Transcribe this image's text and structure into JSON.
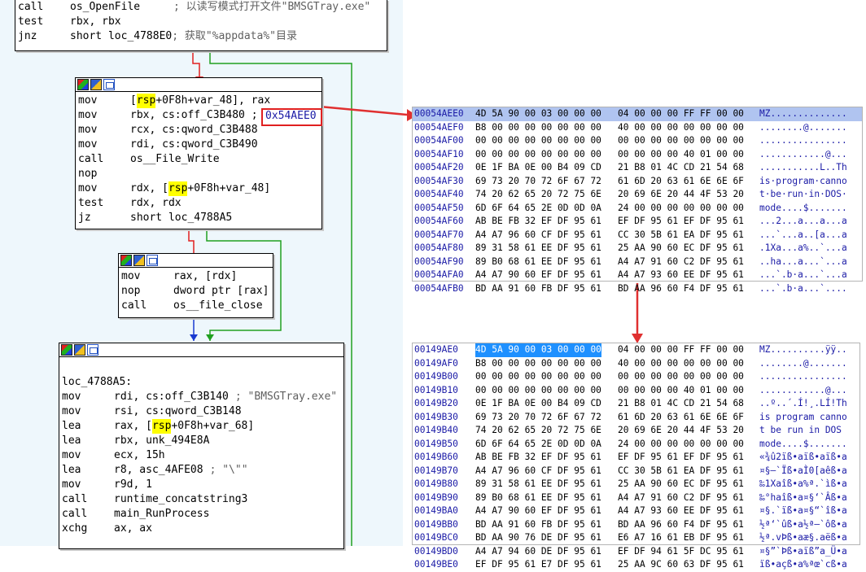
{
  "top_block": [
    {
      "m": "call",
      "o": "os_OpenFile",
      "c": "; 以读写模式打开文件\"BMSGTray.exe\""
    },
    {
      "m": "test",
      "o": "rbx, rbx",
      "c": ""
    },
    {
      "m": "jnz",
      "o": "short loc_4788E0",
      "c": "; 获取\"%appdata%\"目录"
    }
  ],
  "block2": [
    {
      "m": "mov",
      "pre": "[",
      "hl": "rsp",
      "post": "+0F8h+var_48], rax"
    },
    {
      "m": "mov",
      "pre": "rbx, cs:off_C3B480 ;",
      "hl": "",
      "post": ""
    },
    {
      "m": "mov",
      "pre": "rcx, cs:qword_C3B488",
      "hl": "",
      "post": ""
    },
    {
      "m": "mov",
      "pre": "rdi, cs:qword_C3B490",
      "hl": "",
      "post": ""
    },
    {
      "m": "call",
      "pre": "os__File_Write",
      "hl": "",
      "post": ""
    },
    {
      "m": "nop",
      "pre": "",
      "hl": "",
      "post": ""
    },
    {
      "m": "mov",
      "pre": "rdx, [",
      "hl": "rsp",
      "post": "+0F8h+var_48]"
    },
    {
      "m": "test",
      "pre": "rdx, rdx",
      "hl": "",
      "post": ""
    },
    {
      "m": "jz",
      "pre": "short loc_4788A5",
      "hl": "",
      "post": ""
    }
  ],
  "block2_annot": "0x54AEE0",
  "block3": [
    {
      "m": "mov",
      "o": "rax, [rdx]"
    },
    {
      "m": "nop",
      "o": "dword ptr [rax]"
    },
    {
      "m": "call",
      "o": "os__file_close"
    }
  ],
  "block4_label": "loc_4788A5:",
  "block4": [
    {
      "m": "mov",
      "pre": "rdi, cs:off_C3B140",
      "hl": "",
      "post": "",
      "c": "; \"BMSGTray.exe\""
    },
    {
      "m": "mov",
      "pre": "rsi, cs:qword_C3B148",
      "hl": "",
      "post": "",
      "c": ""
    },
    {
      "m": "lea",
      "pre": "rax, [",
      "hl": "rsp",
      "post": "+0F8h+var_68]",
      "c": ""
    },
    {
      "m": "lea",
      "pre": "rbx, unk_494E8A",
      "hl": "",
      "post": "",
      "c": ""
    },
    {
      "m": "mov",
      "pre": "ecx, 15h",
      "hl": "",
      "post": "",
      "c": ""
    },
    {
      "m": "lea",
      "pre": "r8, asc_4AFE08",
      "hl": "",
      "post": "",
      "c": "; \"\\\"\""
    },
    {
      "m": "mov",
      "pre": "r9d, 1",
      "hl": "",
      "post": "",
      "c": ""
    },
    {
      "m": "call",
      "pre": "runtime_concatstring3",
      "hl": "",
      "post": "",
      "c": ""
    },
    {
      "m": "call",
      "pre": "main_RunProcess",
      "hl": "",
      "post": "",
      "c": ""
    },
    {
      "m": "xchg",
      "pre": "ax, ax",
      "hl": "",
      "post": "",
      "c": ""
    }
  ],
  "hex1": [
    {
      "a": "00054AEE0",
      "b": "4D 5A 90 00 03 00 00 00",
      "c": "04 00 00 00 FF FF 00 00",
      "t": "MZ.............."
    },
    {
      "a": "00054AEF0",
      "b": "B8 00 00 00 00 00 00 00",
      "c": "40 00 00 00 00 00 00 00",
      "t": "........@......."
    },
    {
      "a": "00054AF00",
      "b": "00 00 00 00 00 00 00 00",
      "c": "00 00 00 00 00 00 00 00",
      "t": "................"
    },
    {
      "a": "00054AF10",
      "b": "00 00 00 00 00 00 00 00",
      "c": "00 00 00 00 40 01 00 00",
      "t": "............@..."
    },
    {
      "a": "00054AF20",
      "b": "0E 1F BA 0E 00 B4 09 CD",
      "c": "21 B8 01 4C CD 21 54 68",
      "t": "...........L..Th"
    },
    {
      "a": "00054AF30",
      "b": "69 73 20 70 72 6F 67 72",
      "c": "61 6D 20 63 61 6E 6E 6F",
      "t": "is·program·canno"
    },
    {
      "a": "00054AF40",
      "b": "74 20 62 65 20 72 75 6E",
      "c": "20 69 6E 20 44 4F 53 20",
      "t": "t·be·run·in·DOS·"
    },
    {
      "a": "00054AF50",
      "b": "6D 6F 64 65 2E 0D 0D 0A",
      "c": "24 00 00 00 00 00 00 00",
      "t": "mode....$......."
    },
    {
      "a": "00054AF60",
      "b": "AB BE FB 32 EF DF 95 61",
      "c": "EF DF 95 61 EF DF 95 61",
      "t": "...2...a...a...a"
    },
    {
      "a": "00054AF70",
      "b": "A4 A7 96 60 CF DF 95 61",
      "c": "CC 30 5B 61 EA DF 95 61",
      "t": "...`...a..[a...a"
    },
    {
      "a": "00054AF80",
      "b": "89 31 58 61 EE DF 95 61",
      "c": "25 AA 90 60 EC DF 95 61",
      "t": ".1Xa...a%..`...a"
    },
    {
      "a": "00054AF90",
      "b": "89 B0 68 61 EE DF 95 61",
      "c": "A4 A7 91 60 C2 DF 95 61",
      "t": "..ha...a...`...a"
    },
    {
      "a": "00054AFA0",
      "b": "A4 A7 90 60 EF DF 95 61",
      "c": "A4 A7 93 60 EE DF 95 61",
      "t": "...`.b·a...`...a"
    },
    {
      "a": "00054AFB0",
      "b": "BD AA 91 60 FB DF 95 61",
      "c": "BD AA 96 60 F4 DF 95 61",
      "t": "...`.b·a...`...."
    }
  ],
  "hex2": [
    {
      "a": "00149AE0",
      "b": "4D 5A 90 00 03 00 00 00",
      "c": "04 00 00 00 FF FF 00 00",
      "t": "MZ..........ÿÿ.."
    },
    {
      "a": "00149AF0",
      "b": "B8 00 00 00 00 00 00 00",
      "c": "40 00 00 00 00 00 00 00",
      "t": "........@......."
    },
    {
      "a": "00149B00",
      "b": "00 00 00 00 00 00 00 00",
      "c": "00 00 00 00 00 00 00 00",
      "t": "................"
    },
    {
      "a": "00149B10",
      "b": "00 00 00 00 00 00 00 00",
      "c": "00 00 00 00 40 01 00 00",
      "t": "............@..."
    },
    {
      "a": "00149B20",
      "b": "0E 1F BA 0E 00 B4 09 CD",
      "c": "21 B8 01 4C CD 21 54 68",
      "t": "..º..´.Í!¸.LÍ!Th"
    },
    {
      "a": "00149B30",
      "b": "69 73 20 70 72 6F 67 72",
      "c": "61 6D 20 63 61 6E 6E 6F",
      "t": "is program canno"
    },
    {
      "a": "00149B40",
      "b": "74 20 62 65 20 72 75 6E",
      "c": "20 69 6E 20 44 4F 53 20",
      "t": "t be run in DOS "
    },
    {
      "a": "00149B50",
      "b": "6D 6F 64 65 2E 0D 0D 0A",
      "c": "24 00 00 00 00 00 00 00",
      "t": "mode....$......."
    },
    {
      "a": "00149B60",
      "b": "AB BE FB 32 EF DF 95 61",
      "c": "EF DF 95 61 EF DF 95 61",
      "t": "«¾û2ïß•aïß•aïß•a"
    },
    {
      "a": "00149B70",
      "b": "A4 A7 96 60 CF DF 95 61",
      "c": "CC 30 5B 61 EA DF 95 61",
      "t": "¤§–`Ïß•aÌ0[aêß•a"
    },
    {
      "a": "00149B80",
      "b": "89 31 58 61 EE DF 95 61",
      "c": "25 AA 90 60 EC DF 95 61",
      "t": "‰1Xaîß•a%ª.`ìß•a"
    },
    {
      "a": "00149B90",
      "b": "89 B0 68 61 EE DF 95 61",
      "c": "A4 A7 91 60 C2 DF 95 61",
      "t": "‰°haîß•a¤§‘`Âß•a"
    },
    {
      "a": "00149BA0",
      "b": "A4 A7 90 60 EF DF 95 61",
      "c": "A4 A7 93 60 EE DF 95 61",
      "t": "¤§.`ïß•a¤§“`îß•a"
    },
    {
      "a": "00149BB0",
      "b": "BD AA 91 60 FB DF 95 61",
      "c": "BD AA 96 60 F4 DF 95 61",
      "t": "½ª‘`ûß•a½ª–`ôß•a"
    },
    {
      "a": "00149BC0",
      "b": "BD AA 90 76 DE DF 95 61",
      "c": "E6 A7 16 61 EB DF 95 61",
      "t": "½ª.vÞß•aæ§.aëß•a"
    },
    {
      "a": "00149BD0",
      "b": "A4 A7 94 60 DE DF 95 61",
      "c": "EF DF 94 61 5F DC 95 61",
      "t": "¤§”`Þß•aïß”a_Ü•a"
    },
    {
      "a": "00149BE0",
      "b": "EF DF 95 61 E7 DF 95 61",
      "c": "25 AA 9C 60 63 DF 95 61",
      "t": "ïß•açß•a%ªœ`cß•a"
    }
  ]
}
